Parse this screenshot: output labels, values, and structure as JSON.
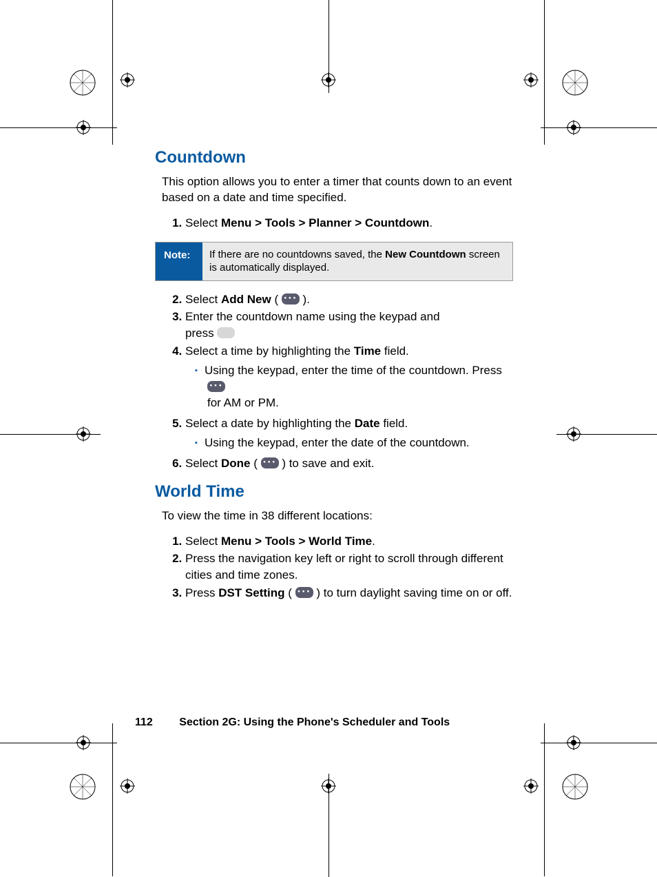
{
  "sections": {
    "countdown": {
      "heading": "Countdown",
      "intro": "This option allows you to enter a timer that counts down to an event based on a date and time specified.",
      "step1_pre": "Select ",
      "step1_bold": "Menu > Tools > Planner > Countdown",
      "step1_post": ".",
      "note_label": "Note:",
      "note_pre": "If there are no countdowns saved, the ",
      "note_bold": "New Countdown",
      "note_post": " screen is automatically displayed.",
      "step2_pre": "Select ",
      "step2_bold": "Add New",
      "step2_post": " ( ",
      "step2_tail": " ).",
      "step3a": "Enter the countdown name using the keypad and",
      "step3b": "press ",
      "step4_pre": "Select a time by highlighting the ",
      "step4_bold": "Time",
      "step4_post": " field.",
      "step4_sub_a": "Using the keypad, enter the time of the countdown. Press ",
      "step4_sub_b": "for AM or PM.",
      "step5_pre": "Select a date by highlighting the ",
      "step5_bold": "Date",
      "step5_post": " field.",
      "step5_sub": "Using the keypad, enter the date of the countdown.",
      "step6_pre": "Select ",
      "step6_bold": "Done",
      "step6_post": " ( ",
      "step6_tail": " ) to save and exit."
    },
    "worldtime": {
      "heading": "World Time",
      "intro": "To view the time in 38 different locations:",
      "step1_pre": "Select ",
      "step1_bold": "Menu > Tools > World Time",
      "step1_post": ".",
      "step2": "Press the navigation key left or right to scroll through different cities and time zones.",
      "step3_pre": "Press ",
      "step3_bold": "DST Setting",
      "step3_post": " ( ",
      "step3_tail": " ) to turn daylight saving time on or off."
    }
  },
  "footer": {
    "page": "112",
    "section": "Section 2G: Using the Phone's Scheduler and Tools"
  }
}
